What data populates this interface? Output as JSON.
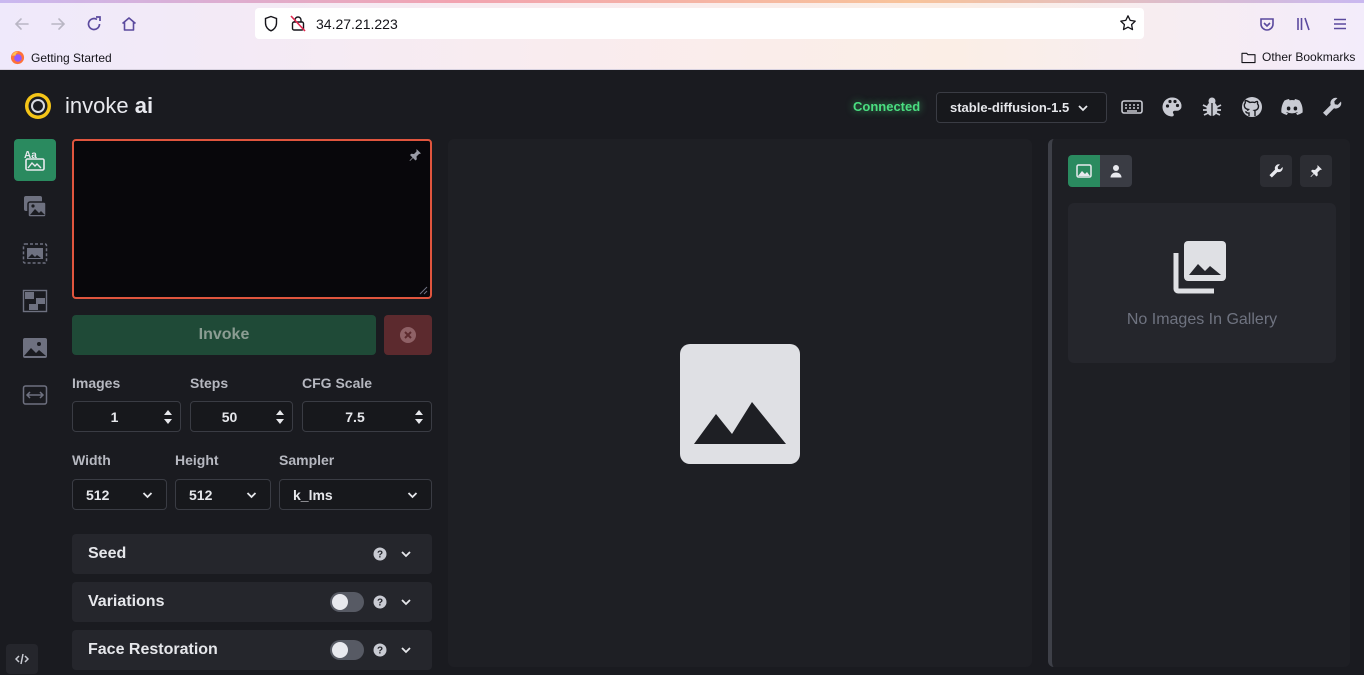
{
  "browser": {
    "url": "34.27.21.223",
    "bookmarks": {
      "left": "Getting Started",
      "right": "Other Bookmarks"
    }
  },
  "header": {
    "logo_text_regular": "invoke ",
    "logo_text_bold": "ai",
    "status": "Connected",
    "model": "stable-diffusion-1.5",
    "icons": [
      "keyboard-icon",
      "palette-icon",
      "bug-icon",
      "github-icon",
      "discord-icon",
      "wrench-icon"
    ]
  },
  "tabs": [
    "text-to-image",
    "image-to-image",
    "inpainting",
    "outpainting",
    "nodes",
    "postprocessing"
  ],
  "options": {
    "prompt_value": "",
    "invoke_label": "Invoke",
    "images": {
      "label": "Images",
      "value": "1"
    },
    "steps": {
      "label": "Steps",
      "value": "50"
    },
    "cfg": {
      "label": "CFG Scale",
      "value": "7.5"
    },
    "width": {
      "label": "Width",
      "value": "512"
    },
    "height": {
      "label": "Height",
      "value": "512"
    },
    "sampler": {
      "label": "Sampler",
      "value": "k_lms"
    },
    "accordions": {
      "seed": "Seed",
      "variations": "Variations",
      "face_restoration": "Face Restoration"
    }
  },
  "gallery": {
    "empty_message": "No Images In Gallery"
  },
  "colors": {
    "accent_green": "#2a8a5f",
    "status_green": "#4ade80",
    "prompt_border": "#e0553e"
  }
}
